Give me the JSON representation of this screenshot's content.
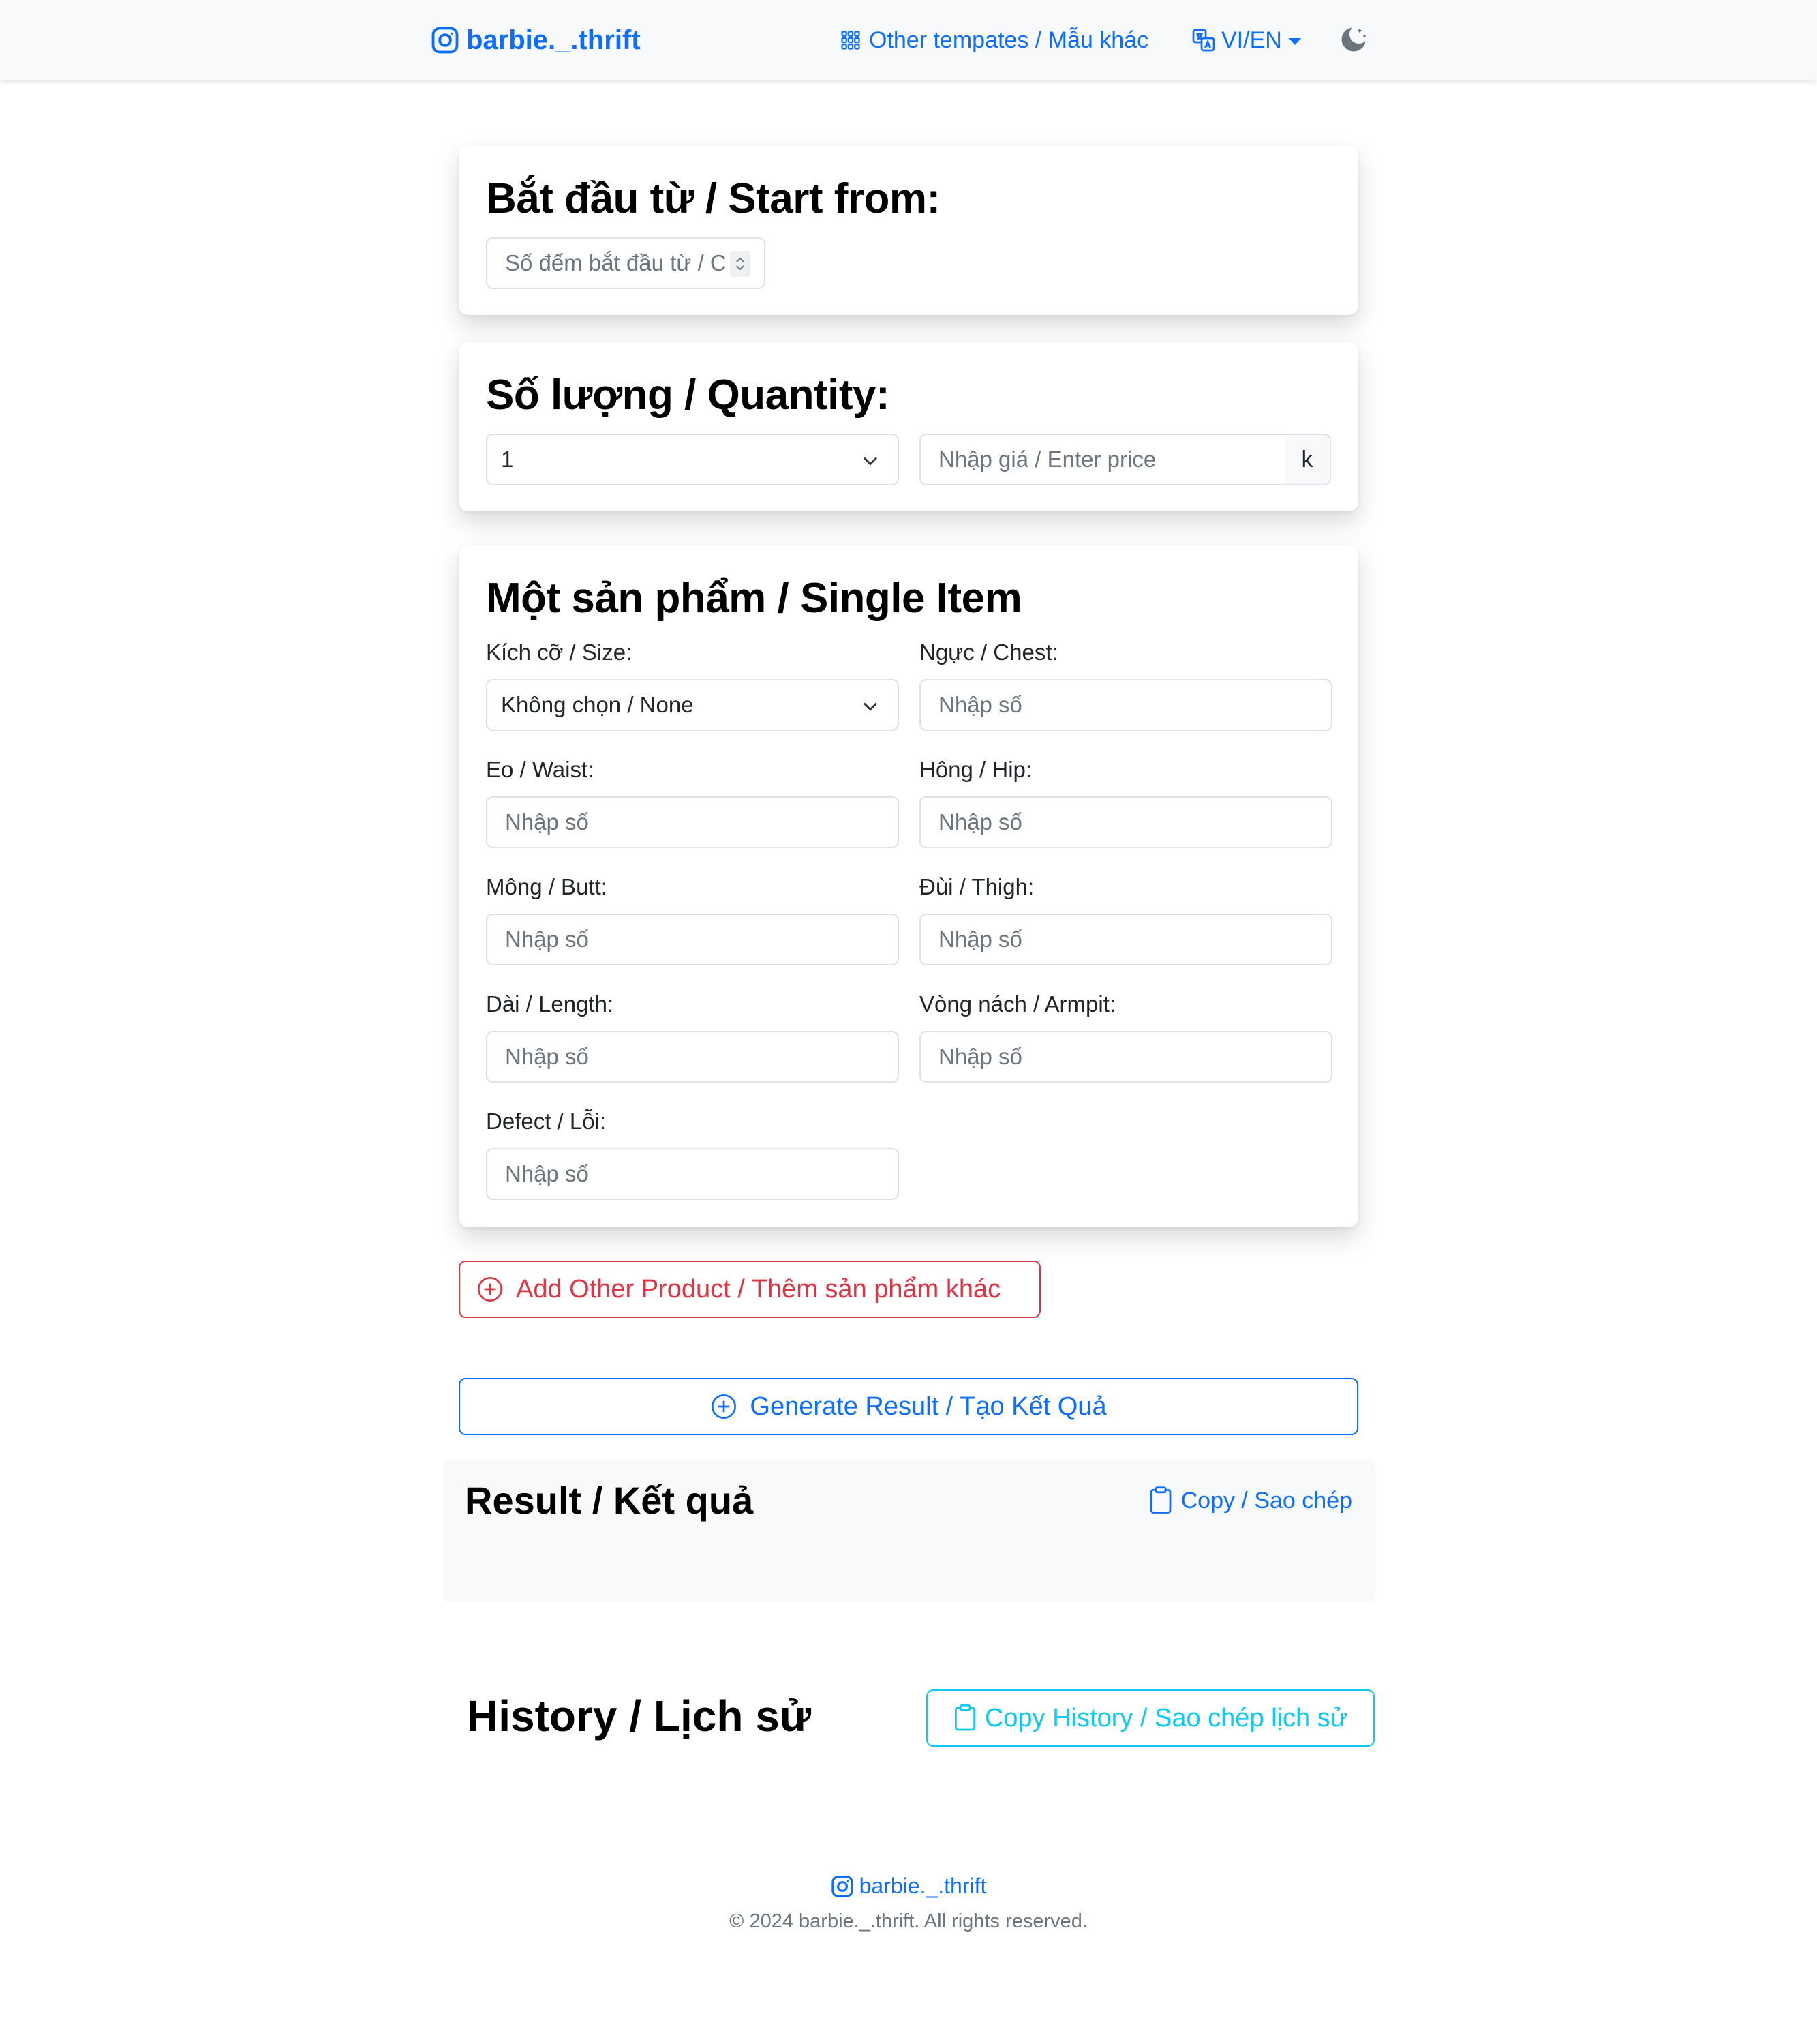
{
  "navbar": {
    "brand": "barbie._.thrift",
    "templates_link": "Other tempates / Mẫu khác",
    "lang_toggle": "VI/EN"
  },
  "start_card": {
    "title": "Bắt đầu từ / Start from:",
    "input_placeholder": "Số đếm bắt đầu từ / C"
  },
  "quantity_card": {
    "title": "Số lượng / Quantity:",
    "quantity_value": "1",
    "price_placeholder": "Nhập giá / Enter price",
    "price_suffix": "k"
  },
  "item_card": {
    "title": "Một sản phẩm / Single Item",
    "fields": [
      {
        "label": "Kích cỡ / Size:",
        "value": "Không chọn / None"
      },
      {
        "label": "Ngực / Chest:",
        "placeholder": "Nhập số"
      },
      {
        "label": "Eo / Waist:",
        "placeholder": "Nhập số"
      },
      {
        "label": "Hông / Hip:",
        "placeholder": "Nhập số"
      },
      {
        "label": "Mông / Butt:",
        "placeholder": "Nhập số"
      },
      {
        "label": "Đùi / Thigh:",
        "placeholder": "Nhập số"
      },
      {
        "label": "Dài / Length:",
        "placeholder": "Nhập số"
      },
      {
        "label": "Vòng nách / Armpit:",
        "placeholder": "Nhập số"
      },
      {
        "label": "Defect / Lỗi:",
        "placeholder": "Nhập số"
      }
    ]
  },
  "buttons": {
    "add_product": "Add Other Product / Thêm sản phẩm khác",
    "generate": "Generate Result / Tạo Kết Quả"
  },
  "result": {
    "title": "Result / Kết quả",
    "copy": "Copy / Sao chép"
  },
  "history": {
    "title": "History / Lịch sử",
    "copy": "Copy History / Sao chép lịch sử"
  },
  "footer": {
    "brand": "barbie._.thrift",
    "copyright": "© 2024 barbie._.thrift. All rights reserved."
  },
  "colors": {
    "primary": "#0d6efd",
    "danger": "#dc3545",
    "info": "#0dcaf0",
    "muted": "#6c757d"
  }
}
